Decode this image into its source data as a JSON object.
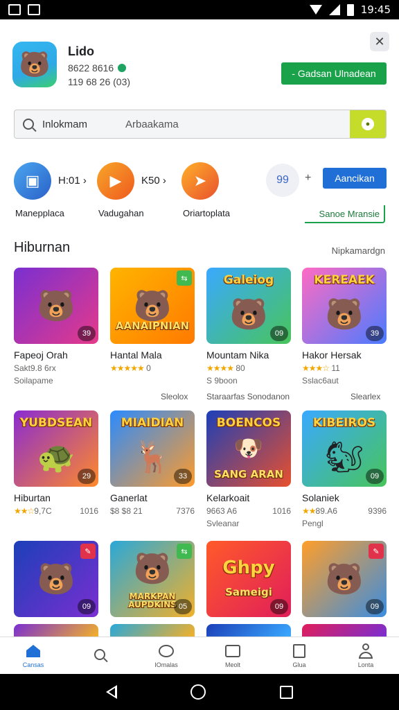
{
  "status_bar": {
    "time": "19:45"
  },
  "app": {
    "name": "Lido",
    "developer": "8622 8616",
    "meta": "119 68 26 (03)",
    "install_label": "- Gadsan Ulnadean",
    "close_symbol": "✕"
  },
  "search": {
    "query_primary": "Inlokmam",
    "query_secondary": "Arbaakama"
  },
  "shortcuts": {
    "items": [
      {
        "value": "H:01 ›",
        "label": "Manepplaca",
        "color": "#3a8de0"
      },
      {
        "value": "K50 ›",
        "label": "Vadugahan",
        "color": "#f08a1d"
      },
      {
        "value": "",
        "label": "Oriartoplata",
        "color": "#e8502d"
      }
    ],
    "face_text": "99",
    "plus": "+",
    "button_label": "Aancikan",
    "link_label": "Sanoe Mransie"
  },
  "section": {
    "title": "Hiburnan",
    "more": "Nipkamardgn"
  },
  "tiles": [
    {
      "name": "Fapeoj Orah",
      "line": "Sakt9.8 6rx",
      "sub": "Soilapame",
      "badge": "39",
      "art_text": "",
      "top_text": "",
      "mascot": "🐻",
      "bg": "linear-gradient(135deg,#7a2fd1,#e53a8a)"
    },
    {
      "name": "Hantal Mala",
      "stars": "★★★★★",
      "line": "0",
      "sub": "",
      "badge": "",
      "art_text": "AANAIPNIAN",
      "top_text": "",
      "mascot": "🐻",
      "bg": "linear-gradient(135deg,#ffb400,#ff7a00)"
    },
    {
      "name": "Mountam Nika",
      "stars": "★★★★",
      "line": "80",
      "sub": "S 9boon",
      "badge": "09",
      "art_text": "",
      "top_text": "Galeiog",
      "mascot": "🐻",
      "bg": "linear-gradient(135deg,#3aa9ff,#48c45a)"
    },
    {
      "name": "Hakor Hersak",
      "stars": "★★★☆",
      "line": "11",
      "sub": "Sslac6aut",
      "badge": "39",
      "art_text": "",
      "top_text": "KEREAEK",
      "mascot": "🐻",
      "bg": "linear-gradient(135deg,#ff6bc3,#4a7bff)"
    },
    {
      "name": "Hiburtan",
      "stars": "★★☆",
      "line": "9,7C",
      "extra": "1016",
      "sub": "",
      "badge": "29",
      "art_text": "",
      "top_text": "YUBDSEAN",
      "mascot": "🐢",
      "bg": "linear-gradient(135deg,#8a2bd1,#ff8a2a)"
    },
    {
      "name": "Ganerlat",
      "line": "$8 $8 21",
      "extra": "7376",
      "sub": "",
      "badge": "33",
      "art_text": "",
      "top_text": "MIAIDIAN",
      "mascot": "🦌",
      "bg": "linear-gradient(135deg,#2a8bff,#ff9b2a)"
    },
    {
      "name": "Kelarkoait",
      "line": "9663 A6",
      "extra": "1016",
      "sub": "Svleanar",
      "badge": "",
      "art_text": "SANG ARAN",
      "top_text": "BOENCOS",
      "mascot": "🐶",
      "bg": "linear-gradient(135deg,#1c3fb8,#e8502d)"
    },
    {
      "name": "Solaniek",
      "stars": "★★",
      "line": "89.A6",
      "extra": "9396",
      "sub": "Pengl",
      "badge": "09",
      "art_text": "",
      "top_text": "KIBEIROS",
      "mascot": "🐿",
      "bg": "linear-gradient(135deg,#3aa9ff,#48c45a)"
    },
    {
      "name": "",
      "line": "",
      "sub": "",
      "badge": "09",
      "art_text": "",
      "top_text": "",
      "mascot": "🐻",
      "bg": "linear-gradient(135deg,#1c3fb8,#7a2fd1)"
    },
    {
      "name": "",
      "line": "",
      "sub": "",
      "badge": "05",
      "art_text": "MARKPAN AUPDKINS",
      "top_text": "",
      "mascot": "🐻",
      "bg": "linear-gradient(135deg,#2aa8d8,#f2b02a)"
    },
    {
      "name": "",
      "line": "",
      "sub": "",
      "badge": "09",
      "art_text": "Sameigi",
      "top_text": "Ghpy",
      "mascot": "",
      "bg": "linear-gradient(135deg,#ff5a2a,#e01e5a)"
    },
    {
      "name": "",
      "line": "",
      "sub": "",
      "badge": "09",
      "art_text": "",
      "top_text": "",
      "mascot": "🐻",
      "bg": "linear-gradient(135deg,#ff9e2a,#3a8de0)"
    }
  ],
  "row_notes": [
    "Sleolox",
    "Staraarfas Sonodanon",
    "Slearlex"
  ],
  "bottom_nav": [
    {
      "label": "Cansas",
      "active": true
    },
    {
      "label": "",
      "active": false
    },
    {
      "label": "IOmalas",
      "active": false
    },
    {
      "label": "Meolt",
      "active": false
    },
    {
      "label": "Glua",
      "active": false
    },
    {
      "label": "Lonta",
      "active": false
    }
  ]
}
